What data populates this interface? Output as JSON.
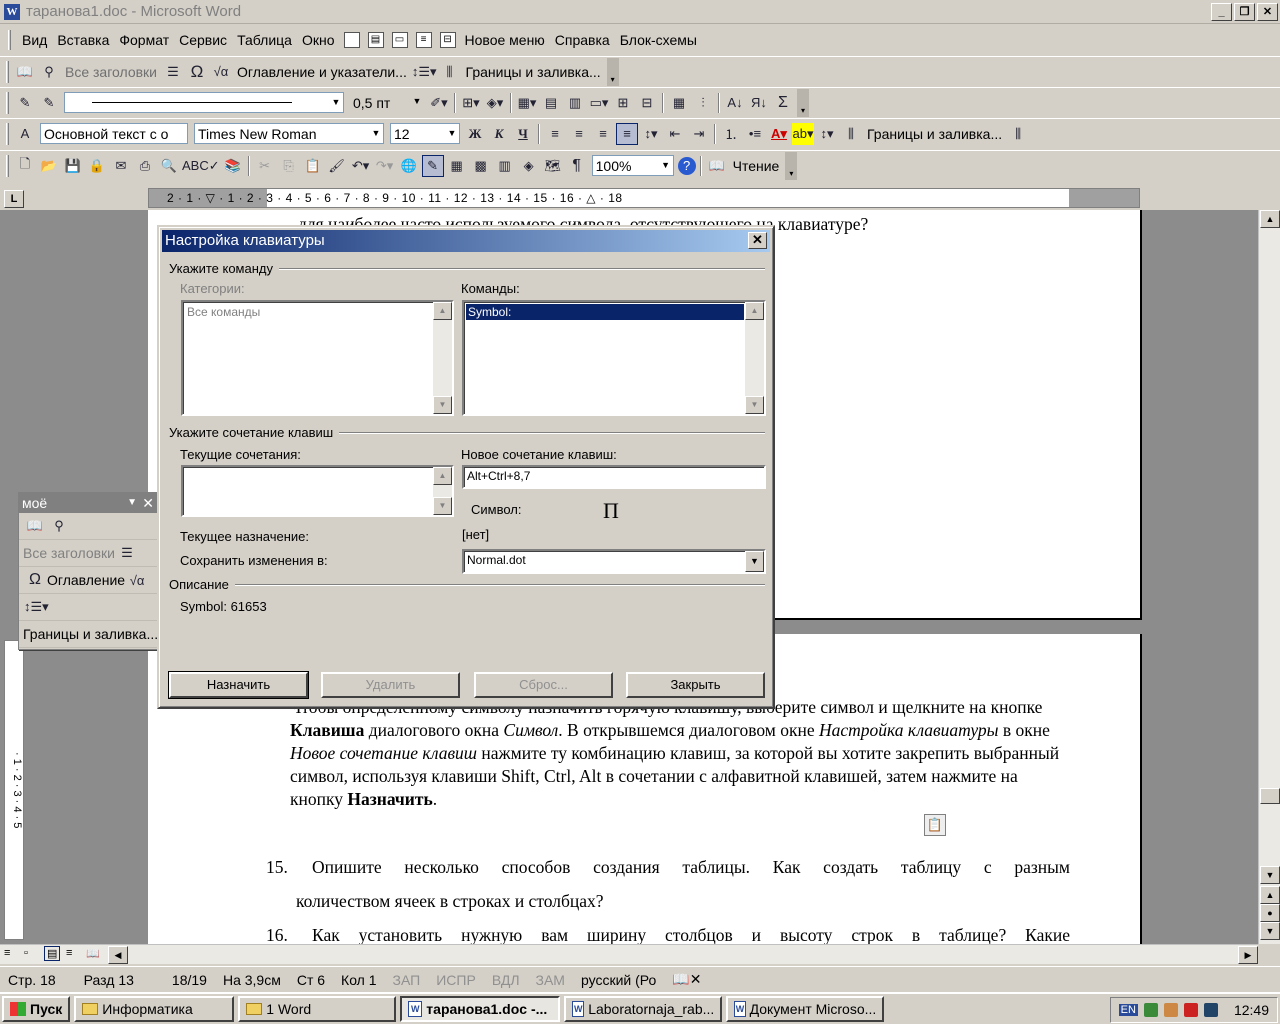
{
  "window": {
    "title": "таранова1.doc - Microsoft Word",
    "min": "_",
    "restore": "❐",
    "close": "✕"
  },
  "menu": {
    "items": [
      "Вид",
      "Вставка",
      "Формат",
      "Сервис",
      "Таблица",
      "Окно",
      "Новое меню",
      "Справка",
      "Блок-схемы"
    ]
  },
  "toolbar1": {
    "headings": "Все заголовки",
    "toc": "Оглавление и указатели...",
    "borders": "Границы и заливка..."
  },
  "toolbar2": {
    "line_width": "0,5 пт"
  },
  "toolbar3": {
    "style": "Основной текст с о",
    "font": "Times New Roman",
    "size": "12",
    "bold": "Ж",
    "italic": "К",
    "underline": "Ч",
    "borders": "Границы и заливка..."
  },
  "toolbar4": {
    "zoom": "100%",
    "reading": "Чтение"
  },
  "ruler": {
    "tab_selector": "L",
    "scale": "2 · 1 · ▽ · 1 · 2 · 3 · 4 · 5 · 6 · 7 · 8 · 9 · 10 · 11 · 12 · 13 · 14 · 15 · 16 · △ · 18"
  },
  "document": {
    "line_top": "для наиболее часто используемого символа, отсутствующего на клавиатуре?",
    "para1_parts": {
      "p1": "Чтобы определенному символу назначить горячую клавишу, выберите символ и щелкните на кнопке ",
      "b1": "Клавиша",
      "p2": " диалогового окна ",
      "i1": "Символ",
      "p3": ". В открывшемся диалоговом окне ",
      "i2": "Настройка клавиатуры",
      "p4": " в окне ",
      "i3": "Новое сочетание клавиш",
      "p5": " нажмите ту комбинацию клавиш, за которой вы хотите закрепить выбранный символ, используя клавиши Shift, Ctrl, Alt в сочетании с алфавитной клавишей, затем нажмите на кнопку ",
      "b2": "Назначить",
      "p6": "."
    },
    "item15_num": "15.",
    "item15_line1": "Опишите несколько способов создания таблицы. Как создать таблицу с разным",
    "item15_line2": "количеством ячеек в строках и столбцах?",
    "item16_num": "16.",
    "item16_line1": "Как установить нужную вам ширину столбцов и высоту строк в таблице? Какие"
  },
  "float_toolbar": {
    "title": "моё",
    "headings": "Все заголовки",
    "toc": "Оглавление",
    "borders": "Границы и заливка..."
  },
  "dialog": {
    "title": "Настройка клавиатуры",
    "group_command": "Укажите команду",
    "categories_label": "Категории:",
    "categories_item": "Все команды",
    "commands_label": "Команды:",
    "commands_item": "Symbol:",
    "group_keys": "Укажите сочетание клавиш",
    "current_keys_label": "Текущие сочетания:",
    "new_keys_label": "Новое сочетание клавиш:",
    "new_keys_value": "Alt+Ctrl+8,7",
    "symbol_label": "Символ:",
    "symbol_char": "Π",
    "current_assign_label": "Текущее назначение:",
    "current_assign_value": "[нет]",
    "save_in_label": "Сохранить изменения в:",
    "save_in_value": "Normal.dot",
    "group_desc": "Описание",
    "desc_value": "Symbol: 61653",
    "btn_assign": "Назначить",
    "btn_remove": "Удалить",
    "btn_reset": "Сброс...",
    "btn_close": "Закрыть"
  },
  "status": {
    "page": "Стр. 18",
    "section": "Разд 13",
    "pages": "18/19",
    "at": "На 3,9см",
    "line": "Ст 6",
    "col": "Кол 1",
    "rec": "ЗАП",
    "trk": "ИСПР",
    "ext": "ВДЛ",
    "ovr": "ЗАМ",
    "lang": "русский (Ро"
  },
  "taskbar": {
    "start": "Пуск",
    "tasks": [
      "Информатика",
      "1 Word",
      "таранова1.doc -...",
      "Laboratornaja_rab...",
      "Документ Microso..."
    ],
    "lang": "EN",
    "time": "12:49"
  }
}
